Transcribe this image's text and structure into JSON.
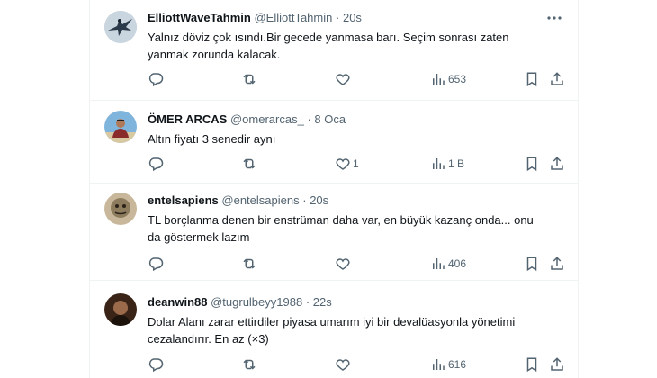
{
  "tweets": [
    {
      "name": "ElliottWaveTahmin",
      "handle": "@ElliottTahmin",
      "dot": "·",
      "time": "20s",
      "text_line1": "Yalnız döviz çok ısındı.Bir gecede yanmasa barı. Seçim sonrası zaten",
      "text_line2": "yanmak zorunda kalacak.",
      "likes": "",
      "views": "653"
    },
    {
      "name": "ÖMER ARCAS",
      "handle": "@omerarcas_",
      "dot": "·",
      "time": "8 Oca",
      "text_line1": "Altın fiyatı 3 senedir aynı",
      "text_line2": "",
      "likes": "1",
      "views": "1 B"
    },
    {
      "name": "entelsapiens",
      "handle": "@entelsapiens",
      "dot": "·",
      "time": "20s",
      "text_line1": "TL borçlanma denen bir enstrüman daha var, en büyük kazanç onda... onu",
      "text_line2": "da göstermek lazım",
      "likes": "",
      "views": "406"
    },
    {
      "name": "deanwin88",
      "handle": "@tugrulbeyy1988",
      "dot": "·",
      "time": "22s",
      "text_line1": "Dolar Alanı zarar ettirdiler piyasa umarım iyi bir devalüasyonla yönetimi",
      "text_line2": "cezalandırır. En az (×3)",
      "likes": "",
      "views": "616"
    }
  ],
  "icons": {
    "reply": "reply-icon",
    "retweet": "retweet-icon",
    "like": "heart-icon",
    "views": "views-icon",
    "bookmark": "bookmark-icon",
    "share": "share-icon",
    "more": "more-icon"
  },
  "colors": {
    "text_primary": "#0f1419",
    "text_secondary": "#536471",
    "divider": "#eff3f4"
  }
}
